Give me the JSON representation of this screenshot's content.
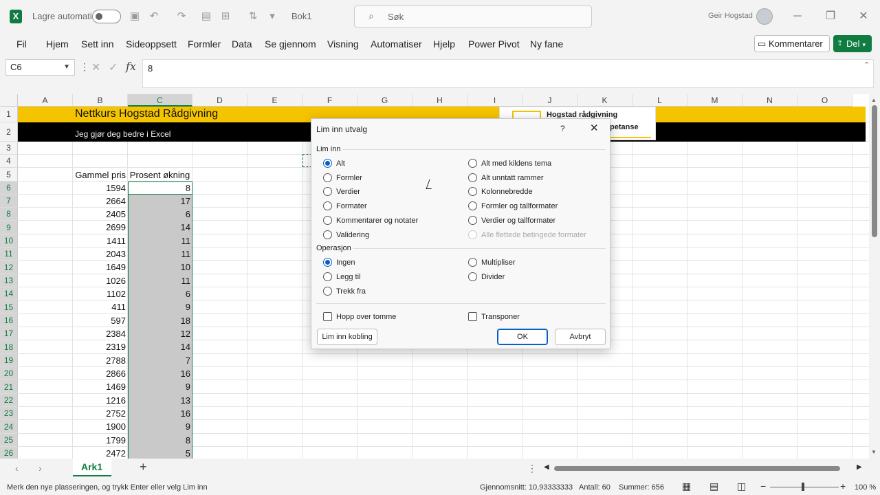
{
  "titlebar": {
    "autosave_label": "Lagre automatisk",
    "doc_name": "Bok1",
    "search_placeholder": "Søk",
    "user_name": "Geir Hogstad"
  },
  "ribbon": {
    "tabs": [
      "Fil",
      "Hjem",
      "Sett inn",
      "Sideoppsett",
      "Formler",
      "Data",
      "Se gjennom",
      "Visning",
      "Automatiser",
      "Hjelp",
      "Power Pivot",
      "Ny fane"
    ],
    "comments_label": "Kommentarer",
    "share_label": "Del"
  },
  "formula_bar": {
    "name_box": "C6",
    "value": "8"
  },
  "grid": {
    "columns": [
      "A",
      "B",
      "C",
      "D",
      "E",
      "F",
      "G",
      "H",
      "I",
      "J",
      "K",
      "L",
      "M",
      "N",
      "O"
    ],
    "rows": [
      "1",
      "2",
      "3",
      "4",
      "5",
      "6",
      "7",
      "8",
      "9",
      "10",
      "11",
      "12",
      "13",
      "14",
      "15",
      "16",
      "17",
      "18",
      "19",
      "20",
      "21",
      "22",
      "23",
      "24",
      "25",
      "26"
    ],
    "banner_title": "Nettkurs Hogstad Rådgivning",
    "banner_subtitle": "Jeg gjør deg bedre i Excel",
    "logo_line1": "Hogstad rådgivning",
    "logo_line2": "petanse",
    "header_b": "Gammel pris",
    "header_c": "Prosent økning",
    "data_b": [
      "1594",
      "2664",
      "2405",
      "2699",
      "1411",
      "2043",
      "1649",
      "1026",
      "1102",
      "411",
      "597",
      "2384",
      "2319",
      "2788",
      "2866",
      "1469",
      "1216",
      "2752",
      "1900",
      "1799",
      "2472"
    ],
    "data_c": [
      "8",
      "17",
      "6",
      "14",
      "11",
      "11",
      "10",
      "11",
      "6",
      "9",
      "18",
      "12",
      "14",
      "7",
      "16",
      "9",
      "13",
      "16",
      "9",
      "8",
      "5"
    ]
  },
  "dialog": {
    "title": "Lim inn utvalg",
    "help": "?",
    "section_paste": "Lim inn",
    "paste_left": [
      "Alt",
      "Formler",
      "Verdier",
      "Formater",
      "Kommentarer og notater",
      "Validering"
    ],
    "paste_right": [
      "Alt med kildens tema",
      "Alt unntatt rammer",
      "Kolonnebredde",
      "Formler og tallformater",
      "Verdier og tallformater",
      "Alle flettede betingede formater"
    ],
    "section_operation": "Operasjon",
    "op_left": [
      "Ingen",
      "Legg til",
      "Trekk fra"
    ],
    "op_right": [
      "Multipliser",
      "Divider"
    ],
    "skip_blanks": "Hopp over tomme",
    "transpose": "Transponer",
    "paste_link": "Lim inn kobling",
    "ok": "OK",
    "cancel": "Avbryt"
  },
  "sheets": {
    "active": "Ark1",
    "add": "+"
  },
  "status": {
    "message": "Merk den nye plasseringen, og trykk Enter eller velg Lim inn",
    "average": "Gjennomsnitt: 10,93333333",
    "count": "Antall: 60",
    "sum": "Summer: 656",
    "zoom": "100 %"
  },
  "colors": {
    "excel_green": "#107c41",
    "banner_yellow": "#f5c400",
    "banner_black": "#000000",
    "selection_gray": "#c9c9c9",
    "accent_blue": "#0a5fc4"
  }
}
